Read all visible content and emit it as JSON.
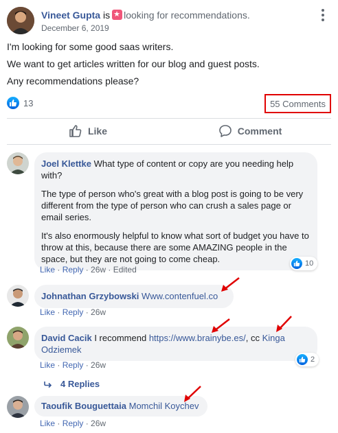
{
  "post": {
    "author": "Vineet Gupta",
    "is_word": "is",
    "activity": "looking for recommendations.",
    "activity_icon": "recommendation-star-icon",
    "date": "December 6, 2019",
    "body": [
      "I'm looking for some good saas writers.",
      "We want to get articles written for our blog and guest posts.",
      "Any recommendations please?"
    ],
    "reaction_count": "13",
    "comments_count": "55 Comments",
    "highlight_color": "#e00000"
  },
  "actions": {
    "like_label": "Like",
    "comment_label": "Comment"
  },
  "comments": [
    {
      "author": "Joel Klettke",
      "paragraphs": [
        "What type of content or copy are you needing help with?",
        "The type of person who's great with a blog post is going to be very different from the type of person who can crush a sales page or email series.",
        "It's also enormously helpful to know what sort of budget you have to throw at this, because there are some AMAZING people in the space, but they are not going to come cheap."
      ],
      "like": "Like",
      "reply": "Reply",
      "time": "26w",
      "edited": "Edited",
      "reactions": "10"
    },
    {
      "author": "Johnathan Grzybowski",
      "text": "Www.contenfuel.co",
      "like": "Like",
      "reply": "Reply",
      "time": "26w"
    },
    {
      "author": "David Cacik",
      "text_before": "I recommend",
      "link": "https://www.brainybe.es/",
      "text_mid": ", cc",
      "mention": "Kinga Odziemek",
      "like": "Like",
      "reply": "Reply",
      "time": "26w",
      "reactions": "2",
      "replies": "4 Replies"
    },
    {
      "author": "Taoufik Bouguettaia",
      "mention": "Momchil Koychev",
      "like": "Like",
      "reply": "Reply",
      "time": "26w"
    }
  ],
  "colors": {
    "link": "#385898",
    "meta": "#606770",
    "bubble": "#f2f3f5",
    "annotation_arrow": "#e00000"
  }
}
